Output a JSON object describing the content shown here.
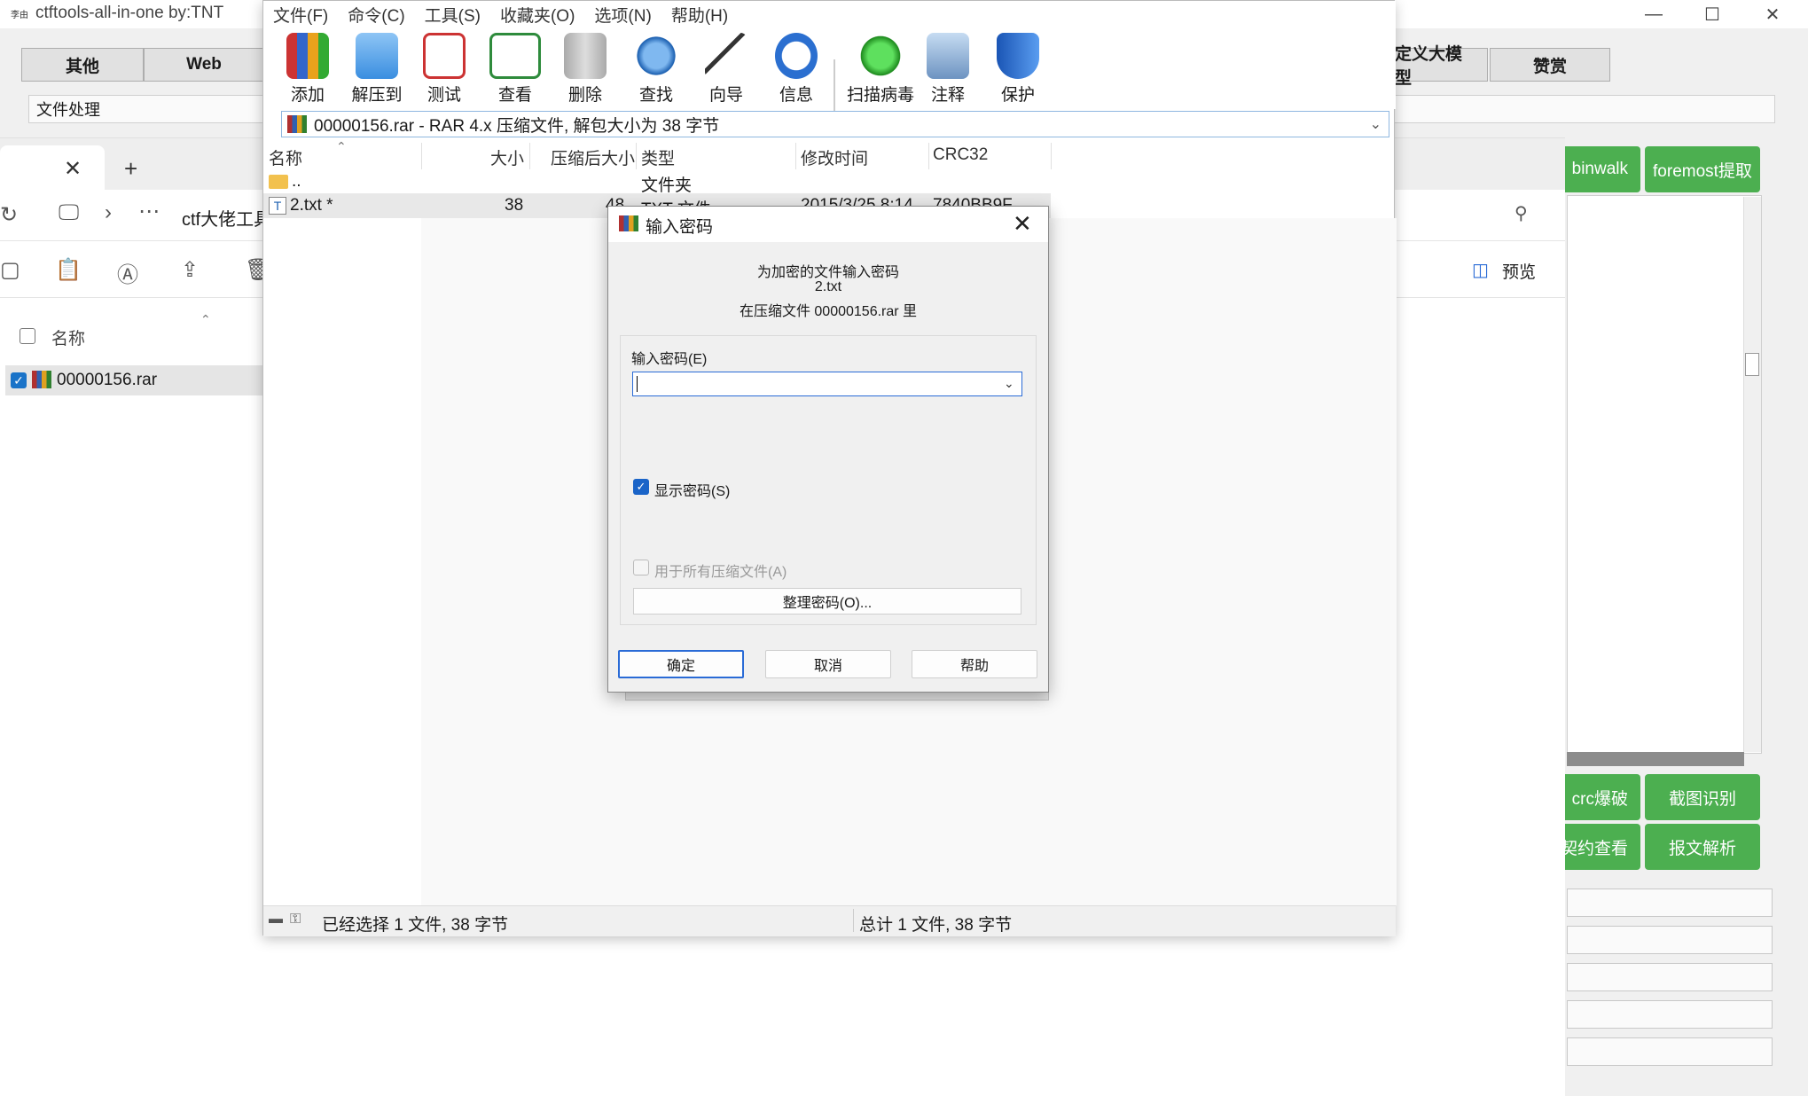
{
  "ctf": {
    "title": "ctftools-all-in-one   by:TNT",
    "title_icon": "李由",
    "tabs": [
      "其他",
      "Web",
      "定义大模型",
      "赞赏"
    ],
    "section": "文件处理",
    "green_buttons_top": [
      "binwalk",
      "foremost提取"
    ],
    "green_buttons_mid": [
      "crc爆破",
      "截图识别"
    ],
    "green_buttons_bot": [
      "契约查看",
      "报文解析"
    ],
    "stray_text": "。"
  },
  "explorer": {
    "breadcrumb": "ctf大佬工具",
    "preview_label": "预览",
    "column_name": "名称",
    "file_row": "00000156.rar"
  },
  "winrar": {
    "menu": [
      "文件(F)",
      "命令(C)",
      "工具(S)",
      "收藏夹(O)",
      "选项(N)",
      "帮助(H)"
    ],
    "toolbar": [
      "添加",
      "解压到",
      "测试",
      "查看",
      "删除",
      "查找",
      "向导",
      "信息",
      "扫描病毒",
      "注释",
      "保护"
    ],
    "path": "00000156.rar - RAR 4.x 压缩文件, 解包大小为 38 字节",
    "columns": [
      "名称",
      "大小",
      "压缩后大小",
      "类型",
      "修改时间",
      "CRC32"
    ],
    "rows": [
      {
        "name": "..",
        "size": "",
        "packed": "",
        "type": "文件夹",
        "modified": "",
        "crc": ""
      },
      {
        "name": "2.txt *",
        "size": "38",
        "packed": "48",
        "type": "TXT 文件",
        "modified": "2015/3/25 8:14",
        "crc": "7840BB9F"
      }
    ],
    "status_left": "已经选择 1 文件, 38 字节",
    "status_right": "总计 1 文件, 38 字节"
  },
  "dialog": {
    "title": "输入密码",
    "info_line1": "为加密的文件输入密码",
    "info_line2": "2.txt",
    "info_line3": "在压缩文件 00000156.rar 里",
    "password_label": "输入密码(E)",
    "password_value": "",
    "show_password": "显示密码(S)",
    "use_for_all": "用于所有压缩文件(A)",
    "organize": "整理密码(O)...",
    "ok": "确定",
    "cancel": "取消",
    "help": "帮助"
  },
  "colors": {
    "accent_blue": "#2a6bd6",
    "green_button": "#4caf50"
  }
}
